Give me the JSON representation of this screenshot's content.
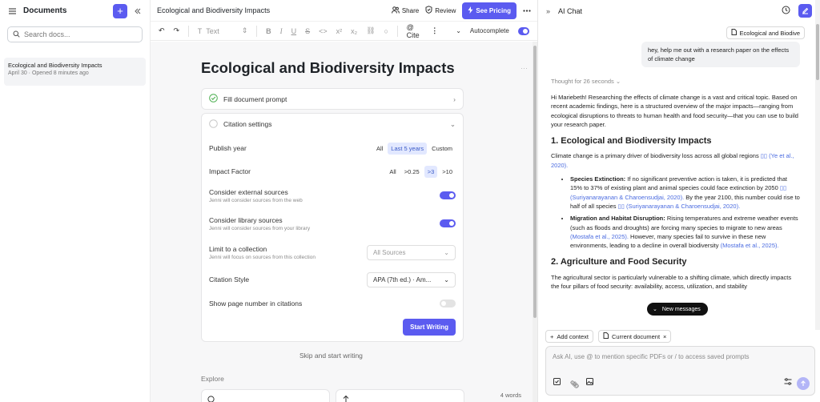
{
  "sidebar": {
    "title": "Documents",
    "new_doc": "+",
    "search_placeholder": "Search docs...",
    "doc": {
      "title": "Ecological and Biodiversity Impacts",
      "meta": "April 30 · Opened 8 minutes ago"
    }
  },
  "editor": {
    "doc_title": "Ecological and Biodiversity Impacts",
    "share": "Share",
    "review": "Review",
    "pricing": "See Pricing",
    "toolbar": {
      "text_style": "Text",
      "cite": "Cite",
      "autocomplete": "Autocomplete"
    },
    "heading": "Ecological and Biodiversity Impacts",
    "fill_prompt": "Fill document prompt",
    "citation_settings": "Citation settings",
    "publish_year": {
      "label": "Publish year",
      "options": [
        "All",
        "Last 5 years",
        "Custom"
      ],
      "selected": "Last 5 years"
    },
    "impact_factor": {
      "label": "Impact Factor",
      "options": [
        "All",
        ">0.25",
        ">3",
        ">10"
      ],
      "selected": ">3"
    },
    "external": {
      "label": "Consider external sources",
      "sub": "Jenni will consider sources from the web",
      "on": true
    },
    "library": {
      "label": "Consider library sources",
      "sub": "Jenni will consider sources from your library",
      "on": true
    },
    "collection": {
      "label": "Limit to a collection",
      "sub": "Jenni will focus on sources from this collection",
      "value": "All Sources"
    },
    "style": {
      "label": "Citation Style",
      "value": "APA (7th ed.) · Am..."
    },
    "page_numbers": {
      "label": "Show page number in citations",
      "on": false
    },
    "start": "Start Writing",
    "skip": "Skip and start writing",
    "explore": "Explore",
    "word_count": "4 words"
  },
  "chat": {
    "title": "AI Chat",
    "context_chip": "Ecological and Biodive",
    "user_message": "hey, help me out with a research paper on the effects of climate change",
    "thought": "Thought for 26 seconds",
    "intro": "Hi Mariebeth! Researching the effects of climate change is a vast and critical topic. Based on recent academic findings, here is a structured overview of the major impacts—ranging from ecological disruptions to threats to human health and food security—that you can use to build your research paper.",
    "h1": "1. Ecological and Biodiversity Impacts",
    "p1": "Climate change is a primary driver of biodiversity loss across all global regions",
    "p1_cite": "(Ye et al., 2020).",
    "b1_label": "Species Extinction:",
    "b1_text": "If no significant preventive action is taken, it is predicted that 15% to 37% of existing plant and animal species could face extinction by 2050",
    "b1_cite1": "(Suriyanarayanan & Charoensudjai, 2020).",
    "b1_text2": "By the year 2100, this number could rise to half of all species",
    "b1_cite2": "(Suriyanarayanan & Charoensudjai, 2020).",
    "b2_label": "Migration and Habitat Disruption:",
    "b2_text": "Rising temperatures and extreme weather events (such as floods and droughts) are forcing many species to migrate to new areas",
    "b2_cite1": "(Mostafa et al., 2025).",
    "b2_text2": "However, many species fail to survive in these new environments, leading to a decline in overall biodiversity",
    "b2_cite2": "(Mostafa et al., 2025).",
    "h2": "2. Agriculture and Food Security",
    "p2": "The agricultural sector is particularly vulnerable to a shifting climate, which directly impacts the four pillars of food security: availability, access, utilization, and stability",
    "new_messages": "New messages",
    "add_context": "Add context",
    "current_doc": "Current document",
    "input_placeholder": "Ask AI, use @ to mention specific PDFs or / to access saved prompts"
  },
  "colors": {
    "accent": "#5b5bf0",
    "cite": "#4a6be0"
  }
}
